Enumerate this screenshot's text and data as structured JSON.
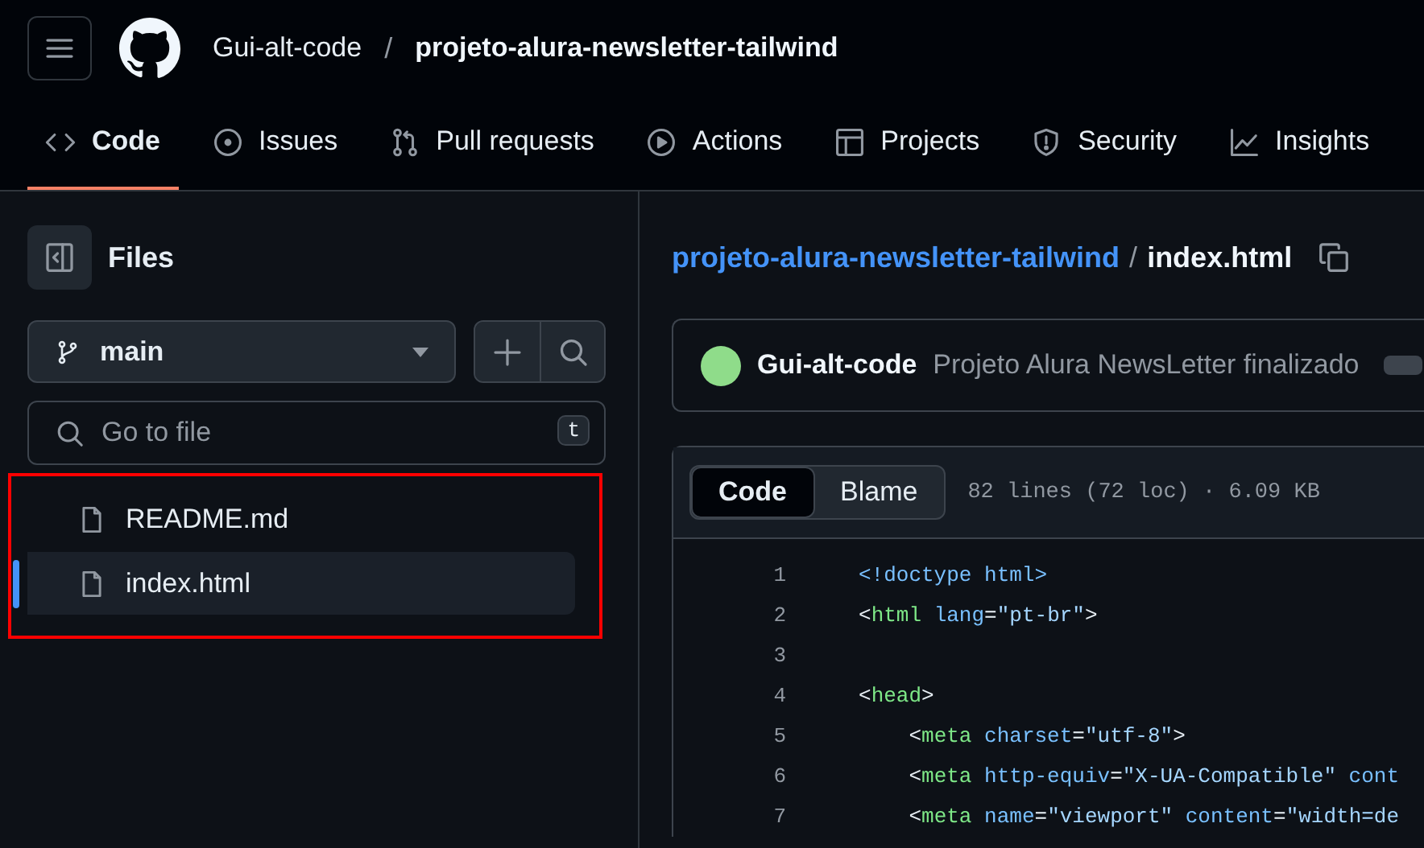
{
  "header": {
    "owner": "Gui-alt-code",
    "separator": "/",
    "repo": "projeto-alura-newsletter-tailwind"
  },
  "tabs": [
    {
      "label": "Code",
      "selected": true
    },
    {
      "label": "Issues",
      "selected": false
    },
    {
      "label": "Pull requests",
      "selected": false
    },
    {
      "label": "Actions",
      "selected": false
    },
    {
      "label": "Projects",
      "selected": false
    },
    {
      "label": "Security",
      "selected": false
    },
    {
      "label": "Insights",
      "selected": false
    }
  ],
  "sidebar": {
    "title": "Files",
    "branch": "main",
    "search": {
      "placeholder": "Go to file",
      "shortcut": "t"
    },
    "files": [
      {
        "name": "README.md",
        "selected": false
      },
      {
        "name": "index.html",
        "selected": true
      }
    ]
  },
  "breadcrumb": {
    "repo": "projeto-alura-newsletter-tailwind",
    "separator": "/",
    "file": "index.html"
  },
  "commit": {
    "author": "Gui-alt-code",
    "message": "Projeto Alura NewsLetter finalizado"
  },
  "file_view": {
    "modes": [
      {
        "label": "Code",
        "selected": true
      },
      {
        "label": "Blame",
        "selected": false
      }
    ],
    "info": "82 lines (72 loc) · 6.09 KB",
    "lines": [
      {
        "number": "1",
        "tokens": [
          {
            "text": "<!doctype html>",
            "kind": "attr"
          }
        ]
      },
      {
        "number": "2",
        "tokens": [
          {
            "text": "<",
            "kind": "punct"
          },
          {
            "text": "html",
            "kind": "tag"
          },
          {
            "text": " lang",
            "kind": "attr"
          },
          {
            "text": "=",
            "kind": "punct"
          },
          {
            "text": "\"pt-br\"",
            "kind": "string"
          },
          {
            "text": ">",
            "kind": "punct"
          }
        ]
      },
      {
        "number": "3"
      },
      {
        "number": "4",
        "tokens": [
          {
            "text": "<",
            "kind": "punct"
          },
          {
            "text": "head",
            "kind": "tag"
          },
          {
            "text": ">",
            "kind": "punct"
          }
        ]
      },
      {
        "number": "5",
        "tokens": [
          {
            "text": "    <",
            "kind": "punct"
          },
          {
            "text": "meta",
            "kind": "tag"
          },
          {
            "text": " charset",
            "kind": "attr"
          },
          {
            "text": "=",
            "kind": "punct"
          },
          {
            "text": "\"utf-8\"",
            "kind": "string"
          },
          {
            "text": ">",
            "kind": "punct"
          }
        ]
      },
      {
        "number": "6",
        "tokens": [
          {
            "text": "    <",
            "kind": "punct"
          },
          {
            "text": "meta",
            "kind": "tag"
          },
          {
            "text": " http-equiv",
            "kind": "attr"
          },
          {
            "text": "=",
            "kind": "punct"
          },
          {
            "text": "\"X-UA-Compatible\"",
            "kind": "string"
          },
          {
            "text": " cont",
            "kind": "attr"
          }
        ]
      },
      {
        "number": "7",
        "tokens": [
          {
            "text": "    <",
            "kind": "punct"
          },
          {
            "text": "meta",
            "kind": "tag"
          },
          {
            "text": " name",
            "kind": "attr"
          },
          {
            "text": "=",
            "kind": "punct"
          },
          {
            "text": "\"viewport\"",
            "kind": "string"
          },
          {
            "text": " content",
            "kind": "attr"
          },
          {
            "text": "=",
            "kind": "punct"
          },
          {
            "text": "\"width=de",
            "kind": "string"
          }
        ]
      }
    ]
  }
}
